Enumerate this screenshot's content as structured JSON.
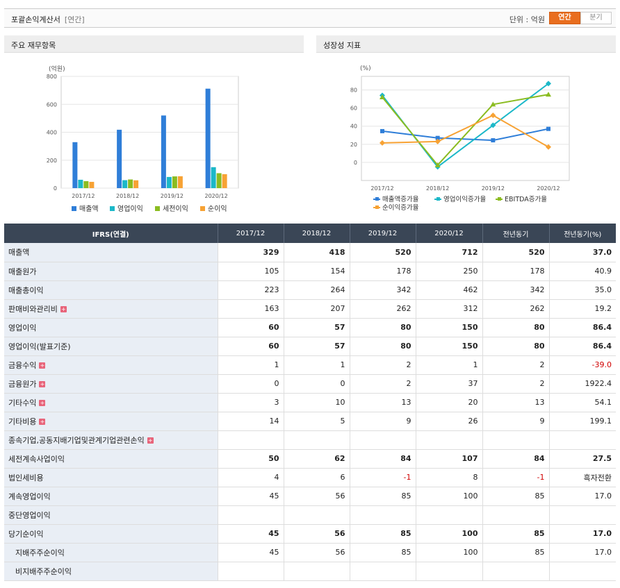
{
  "header": {
    "title": "포괄손익계산서",
    "subtitle": "[연간]",
    "unit_label": "단위 : 억원",
    "tabs": [
      {
        "label": "연간",
        "active": true
      },
      {
        "label": "분기",
        "active": false
      }
    ]
  },
  "panels": {
    "left_title": "주요 재무항목",
    "right_title": "성장성 지표"
  },
  "chart_data": [
    {
      "type": "bar",
      "ylabel": "(억원)",
      "ylim": [
        0,
        800
      ],
      "yticks": [
        0,
        200,
        400,
        600,
        800
      ],
      "categories": [
        "2017/12",
        "2018/12",
        "2019/12",
        "2020/12"
      ],
      "series": [
        {
          "name": "매출액",
          "color": "#2f7ed8",
          "values": [
            329,
            418,
            520,
            712
          ]
        },
        {
          "name": "영업이익",
          "color": "#1cb8c8",
          "values": [
            60,
            57,
            80,
            150
          ]
        },
        {
          "name": "세전이익",
          "color": "#8bbc21",
          "values": [
            50,
            62,
            84,
            107
          ]
        },
        {
          "name": "순이익",
          "color": "#f7a234",
          "values": [
            45,
            56,
            85,
            100
          ]
        }
      ],
      "legend": "bottom"
    },
    {
      "type": "line",
      "ylabel": "(%)",
      "ylim": [
        -20,
        95
      ],
      "yticks": [
        0,
        20,
        40,
        60,
        80
      ],
      "categories": [
        "2017/12",
        "2018/12",
        "2019/12",
        "2020/12"
      ],
      "series": [
        {
          "name": "매출액증가율",
          "color": "#2f7ed8",
          "marker": "square",
          "values": [
            34.5,
            27,
            24.4,
            37
          ]
        },
        {
          "name": "영업이익증가율",
          "color": "#1cb8c8",
          "marker": "diamond",
          "values": [
            74,
            -5,
            41,
            87
          ]
        },
        {
          "name": "EBITDA증가율",
          "color": "#8bbc21",
          "marker": "triangle",
          "values": [
            72,
            -3,
            64,
            75
          ]
        },
        {
          "name": "순이익증가율",
          "color": "#f7a234",
          "marker": "diamond",
          "values": [
            21.5,
            23,
            52,
            17
          ]
        }
      ],
      "legend": "bottom"
    }
  ],
  "table": {
    "headers": [
      "IFRS(연결)",
      "2017/12",
      "2018/12",
      "2019/12",
      "2020/12",
      "전년동기",
      "전년동기(%)"
    ],
    "rows": [
      {
        "label": "매출액",
        "bold": true,
        "plus": false,
        "indent": false,
        "values": [
          "329",
          "418",
          "520",
          "712",
          "520",
          "37.0"
        ],
        "neg": []
      },
      {
        "label": "매출원가",
        "bold": false,
        "plus": false,
        "indent": false,
        "values": [
          "105",
          "154",
          "178",
          "250",
          "178",
          "40.9"
        ],
        "neg": []
      },
      {
        "label": "매출총이익",
        "bold": false,
        "plus": false,
        "indent": false,
        "values": [
          "223",
          "264",
          "342",
          "462",
          "342",
          "35.0"
        ],
        "neg": []
      },
      {
        "label": "판매비와관리비",
        "bold": false,
        "plus": true,
        "indent": false,
        "values": [
          "163",
          "207",
          "262",
          "312",
          "262",
          "19.2"
        ],
        "neg": []
      },
      {
        "label": "영업이익",
        "bold": true,
        "plus": false,
        "indent": false,
        "values": [
          "60",
          "57",
          "80",
          "150",
          "80",
          "86.4"
        ],
        "neg": []
      },
      {
        "label": "영업이익(발표기준)",
        "bold": true,
        "plus": false,
        "indent": false,
        "values": [
          "60",
          "57",
          "80",
          "150",
          "80",
          "86.4"
        ],
        "neg": []
      },
      {
        "label": "금융수익",
        "bold": false,
        "plus": true,
        "indent": false,
        "values": [
          "1",
          "1",
          "2",
          "1",
          "2",
          "-39.0"
        ],
        "neg": [
          5
        ]
      },
      {
        "label": "금융원가",
        "bold": false,
        "plus": true,
        "indent": false,
        "values": [
          "0",
          "0",
          "2",
          "37",
          "2",
          "1922.4"
        ],
        "neg": []
      },
      {
        "label": "기타수익",
        "bold": false,
        "plus": true,
        "indent": false,
        "values": [
          "3",
          "10",
          "13",
          "20",
          "13",
          "54.1"
        ],
        "neg": []
      },
      {
        "label": "기타비용",
        "bold": false,
        "plus": true,
        "indent": false,
        "values": [
          "14",
          "5",
          "9",
          "26",
          "9",
          "199.1"
        ],
        "neg": []
      },
      {
        "label": "종속기업,공동지배기업및관계기업관련손익",
        "bold": false,
        "plus": true,
        "indent": false,
        "values": [
          "",
          "",
          "",
          "",
          "",
          ""
        ],
        "neg": []
      },
      {
        "label": "세전계속사업이익",
        "bold": true,
        "plus": false,
        "indent": false,
        "values": [
          "50",
          "62",
          "84",
          "107",
          "84",
          "27.5"
        ],
        "neg": []
      },
      {
        "label": "법인세비용",
        "bold": false,
        "plus": false,
        "indent": false,
        "values": [
          "4",
          "6",
          "-1",
          "8",
          "-1",
          "흑자전환"
        ],
        "neg": [
          2,
          4
        ]
      },
      {
        "label": "계속영업이익",
        "bold": false,
        "plus": false,
        "indent": false,
        "values": [
          "45",
          "56",
          "85",
          "100",
          "85",
          "17.0"
        ],
        "neg": []
      },
      {
        "label": "중단영업이익",
        "bold": false,
        "plus": false,
        "indent": false,
        "values": [
          "",
          "",
          "",
          "",
          "",
          ""
        ],
        "neg": []
      },
      {
        "label": "당기순이익",
        "bold": true,
        "plus": false,
        "indent": false,
        "values": [
          "45",
          "56",
          "85",
          "100",
          "85",
          "17.0"
        ],
        "neg": []
      },
      {
        "label": "지배주주순이익",
        "bold": false,
        "plus": false,
        "indent": true,
        "values": [
          "45",
          "56",
          "85",
          "100",
          "85",
          "17.0"
        ],
        "neg": []
      },
      {
        "label": "비지배주주순이익",
        "bold": false,
        "plus": false,
        "indent": true,
        "values": [
          "",
          "",
          "",
          "",
          "",
          ""
        ],
        "neg": []
      }
    ]
  }
}
